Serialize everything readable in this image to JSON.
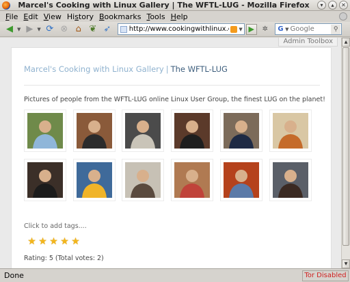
{
  "window": {
    "title": "Marcel's Cooking with Linux Gallery | The WFTL-LUG - Mozilla Firefox",
    "controls": [
      "minimize",
      "maximize",
      "close"
    ]
  },
  "menubar": {
    "items": [
      {
        "label": "File",
        "mnemonic": "F"
      },
      {
        "label": "Edit",
        "mnemonic": "E"
      },
      {
        "label": "View",
        "mnemonic": "V"
      },
      {
        "label": "History",
        "mnemonic": "s"
      },
      {
        "label": "Bookmarks",
        "mnemonic": "B"
      },
      {
        "label": "Tools",
        "mnemonic": "T"
      },
      {
        "label": "Help",
        "mnemonic": "H"
      }
    ]
  },
  "navbar": {
    "url": "http://www.cookingwithlinux.com",
    "search_placeholder": "Google",
    "search_engine_letter": "G"
  },
  "page": {
    "admin_toolbox": "Admin Toolbox",
    "gallery_link": "Marcel's Cooking with Linux Gallery",
    "separator": "|",
    "album_title": "The WFTL-LUG",
    "description": "Pictures of people from the WFTL-LUG online Linux User Group, the finest LUG on the planet!",
    "tags_prompt": "Click to add tags....",
    "stars": 5,
    "max_stars": 5,
    "rating_text": "Rating: 5 (Total votes: 2)"
  },
  "thumbnails": [
    {
      "name": "child-in-blue-dress",
      "bg": "#6f8a4a",
      "fg": "#8fb6d9"
    },
    {
      "name": "man-with-glasses-holding-object",
      "bg": "#8a5a3a",
      "fg": "#2b2b2b"
    },
    {
      "name": "man-in-hat-with-laptop",
      "bg": "#4b4b4b",
      "fg": "#c9c4b8"
    },
    {
      "name": "two-men-posing",
      "bg": "#5b3a2a",
      "fg": "#1e1e1e"
    },
    {
      "name": "couple-with-headset",
      "bg": "#7c6b5a",
      "fg": "#1e2a44"
    },
    {
      "name": "man-holding-cat",
      "bg": "#d9c7a4",
      "fg": "#c56b2a"
    },
    {
      "name": "man-sitting-on-couch",
      "bg": "#3b2f28",
      "fg": "#1c1c1c"
    },
    {
      "name": "penguin-mascot",
      "bg": "#3f6a9a",
      "fg": "#f0b429"
    },
    {
      "name": "bearded-man-portrait",
      "bg": "#c7c1b5",
      "fg": "#5a4a3e"
    },
    {
      "name": "man-in-red-shirt",
      "bg": "#b07a52",
      "fg": "#c0433a"
    },
    {
      "name": "children-in-autumn-leaves",
      "bg": "#b5421c",
      "fg": "#5b7aa8"
    },
    {
      "name": "man-portrait-dark",
      "bg": "#5a5f68",
      "fg": "#3b2a22"
    }
  ],
  "statusbar": {
    "status": "Done",
    "tor_status": "Tor Disabled"
  },
  "colors": {
    "gallery_link": "#8fb2cf",
    "album_title": "#3c5d7c",
    "star": "#f3b61c",
    "tor_status": "#d02020"
  }
}
